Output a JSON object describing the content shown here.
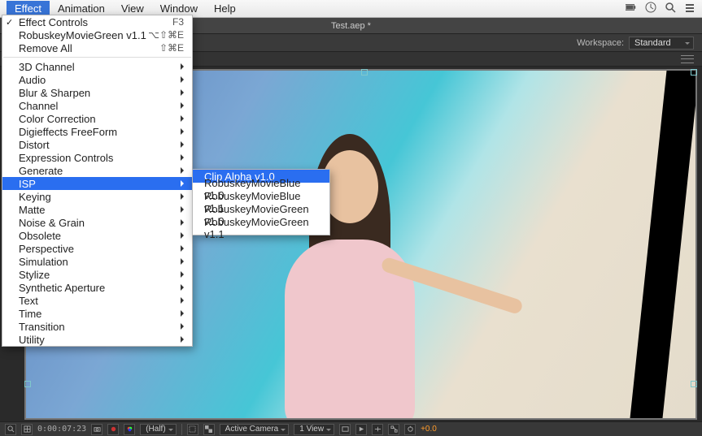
{
  "menubar": {
    "items": [
      "Effect",
      "Animation",
      "View",
      "Window",
      "Help"
    ],
    "selected": "Effect"
  },
  "titlebar": {
    "title": "Test.aep *"
  },
  "workspace": {
    "label": "Workspace:",
    "value": "Standard"
  },
  "effect_menu": {
    "top": [
      {
        "label": "Effect Controls",
        "shortcut": "F3",
        "checked": true
      },
      {
        "label": "RobuskeyMovieGreen v1.1",
        "shortcut": "⌥⇧⌘E"
      },
      {
        "label": "Remove All",
        "shortcut": "⇧⌘E"
      }
    ],
    "categories": [
      "3D Channel",
      "Audio",
      "Blur & Sharpen",
      "Channel",
      "Color Correction",
      "Digieffects FreeForm",
      "Distort",
      "Expression Controls",
      "Generate",
      "ISP",
      "Keying",
      "Matte",
      "Noise & Grain",
      "Obsolete",
      "Perspective",
      "Simulation",
      "Stylize",
      "Synthetic Aperture",
      "Text",
      "Time",
      "Transition",
      "Utility"
    ],
    "highlighted": "ISP"
  },
  "isp_submenu": {
    "items": [
      "Clip Alpha v1.0",
      "RobuskeyMovieBlue v1.0",
      "RobuskeyMovieBlue v1.1",
      "RobuskeyMovieGreen v1.0",
      "RobuskeyMovieGreen v1.1"
    ],
    "highlighted": "Clip Alpha v1.0"
  },
  "footer": {
    "timecode": "0:00:07:23",
    "resolution": "(Half)",
    "camera": "Active Camera",
    "views": "1 View",
    "exposure": "+0.0"
  }
}
